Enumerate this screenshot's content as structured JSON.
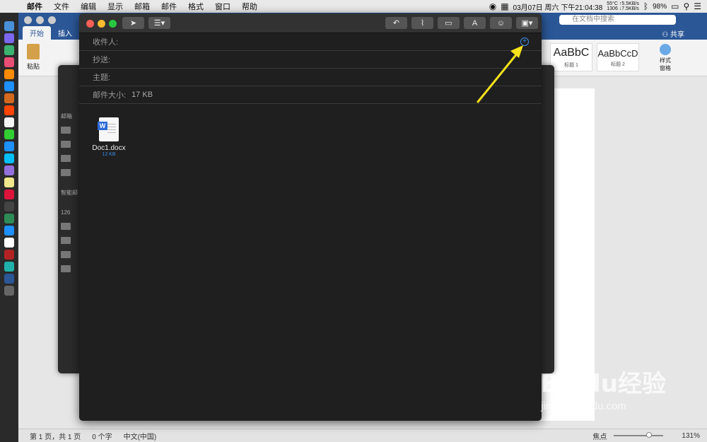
{
  "menubar": {
    "app": "邮件",
    "menus": [
      "文件",
      "编辑",
      "显示",
      "邮箱",
      "邮件",
      "格式",
      "窗口",
      "帮助"
    ],
    "datetime": "03月07日 周六 下午21:04:38",
    "temp": "55°C",
    "rpm": "1306",
    "net_up": "↑5.5KB/s",
    "net_down": "↓7.5KB/s",
    "battery": "98%"
  },
  "word": {
    "tabs": [
      "开始",
      "插入"
    ],
    "search_placeholder": "在文档中搜索",
    "share_label": "共享",
    "paste_label": "粘贴",
    "styles": [
      {
        "sample": "AaBbC",
        "label": "标题 1"
      },
      {
        "sample": "AaBbCcD",
        "label": "标题 2"
      }
    ],
    "style_pane_label": "样式\n窗格",
    "status": {
      "page": "第 1 页，共 1 页",
      "words": "0 个字",
      "language": "中文(中国)",
      "focus": "焦点",
      "zoom": "131%"
    }
  },
  "mail": {
    "sidebar_label": "邮箱",
    "smart_label": "智能邮",
    "count": "126"
  },
  "compose": {
    "fields": {
      "to_label": "收件人:",
      "cc_label": "抄送:",
      "subject_label": "主题:",
      "size_label": "邮件大小:",
      "size_value": "17 KB"
    },
    "attachment": {
      "name": "Doc1.docx",
      "size": "12 KB"
    }
  },
  "watermark": {
    "brand": "Baidu经验",
    "url": "jingyan.baidu.com"
  },
  "colors": {
    "accent": "#3d8ee8",
    "arrow": "#f5e11c",
    "word_blue": "#2b5797"
  }
}
